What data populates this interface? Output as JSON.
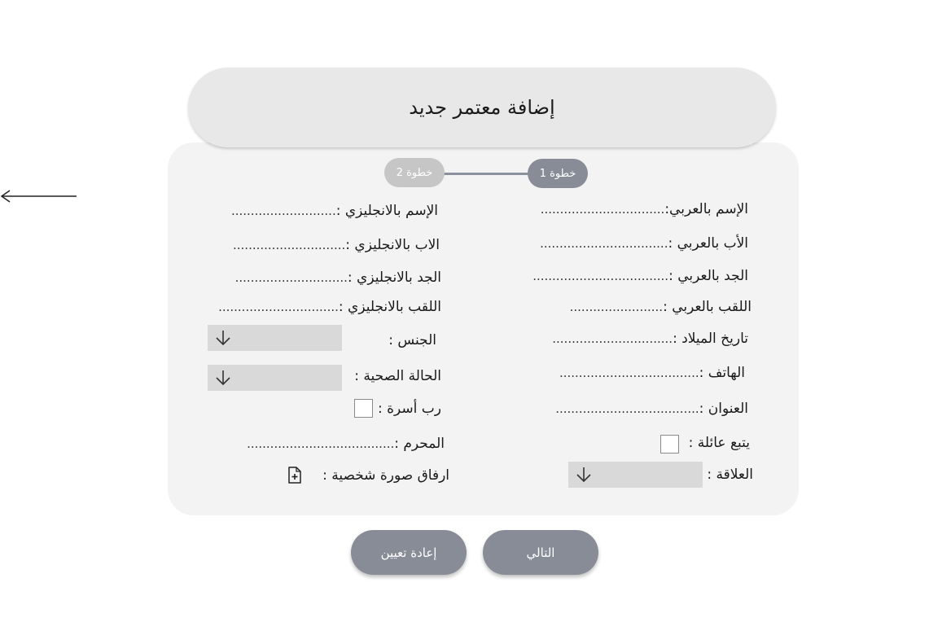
{
  "header": {
    "title": "إضافة معتمر جديد"
  },
  "stepper": {
    "step1": "خطوة 1",
    "step2": "خطوة 2"
  },
  "right_fields": {
    "name_ar": {
      "label": "الإسم  بالعربي:",
      "dots": "................................"
    },
    "father_ar": {
      "label": "الأب بالعربي  :",
      "dots": "................................."
    },
    "grandfather_ar": {
      "label": "الجد بالعربي : ",
      "dots": "..................................."
    },
    "surname_ar": {
      "label": "اللقب بالعربي : ",
      "dots": "........................"
    },
    "birthdate": {
      "label": "تاريخ الميلاد : ",
      "dots": "..............................."
    },
    "phone": {
      "label": "الهاتف : ",
      "dots": "...................................."
    },
    "address": {
      "label": "العنوان : ",
      "dots": "....................................."
    },
    "follows_family": {
      "label": "يتبع عائلة :"
    },
    "relation": {
      "label": "العلاقة :"
    }
  },
  "left_fields": {
    "name_en": {
      "label": "الإسم بالانجليزي : ",
      "dots": "..........................."
    },
    "father_en": {
      "label": "الاب بالانجليزي  :",
      "dots": "............................."
    },
    "grandfather_en": {
      "label": "الجد بالانجليزي : ",
      "dots": "............................."
    },
    "surname_en": {
      "label": "اللقب بالانجليزي : ",
      "dots": "..............................."
    },
    "gender": {
      "label": "الجنس :"
    },
    "health": {
      "label": "الحالة الصحية :"
    },
    "family_head": {
      "label": "رب أسرة :"
    },
    "mahram": {
      "label": "المحرم : ",
      "dots": "......................................"
    },
    "photo": {
      "label": "ارفاق صورة شخصية   :"
    }
  },
  "buttons": {
    "next": "التالي",
    "reset": "إعادة تعيين"
  },
  "colors": {
    "button": "#878c97",
    "card": "#f3f3f3",
    "header": "#e8e8e8",
    "select": "#d9d9d9"
  }
}
